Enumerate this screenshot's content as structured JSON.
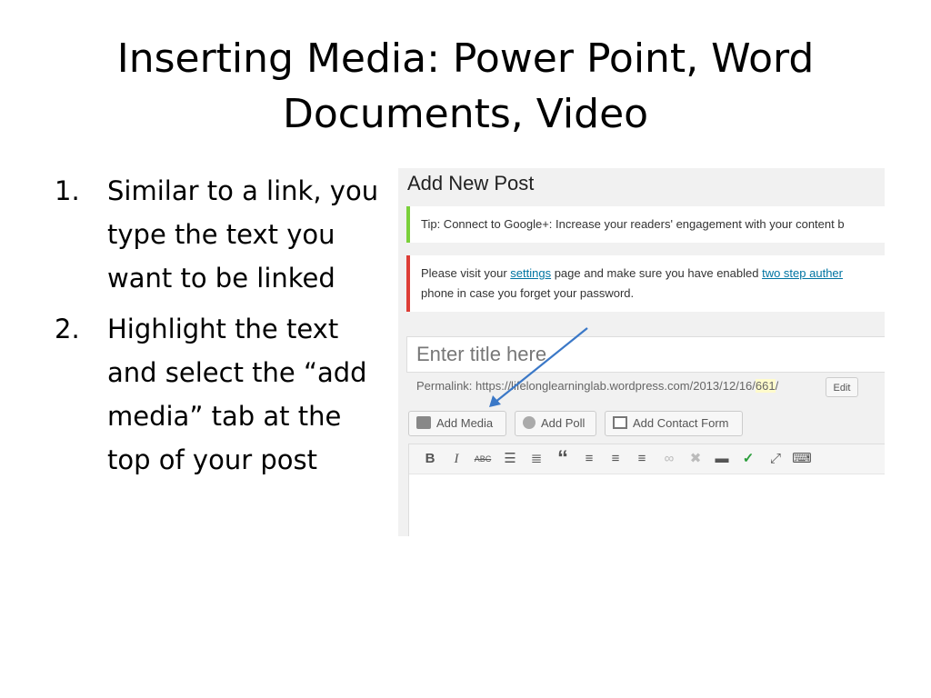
{
  "slide": {
    "title_line1": "Inserting Media: Power Point, Word",
    "title_line2": "Documents, Video",
    "steps": [
      {
        "num": "1.",
        "text": "Similar to a link, you type the text you want to be linked"
      },
      {
        "num": "2.",
        "text": "Highlight the text and select the “add media” tab at the top of your post"
      }
    ]
  },
  "screenshot": {
    "heading": "Add New Post",
    "tip_notice": "Tip: Connect to Google+: Increase your readers' engagement with your content b",
    "warning": {
      "prefix": "Please visit your ",
      "link1": "settings",
      "middle": " page and make sure you have enabled ",
      "link2": "two step auther",
      "line2": "phone in case you forget your password."
    },
    "title_placeholder": "Enter title here",
    "permalink": {
      "label": "Permalink: ",
      "url_start": "https://lifelonglearninglab.wordpress.com/2013/12/16/",
      "url_id": "661",
      "url_end": "/"
    },
    "edit_label": "Edit",
    "buttons": {
      "add_media": "Add Media",
      "add_poll": "Add Poll",
      "add_contact_form": "Add Contact Form"
    },
    "toolbar_icons": [
      {
        "name": "bold-icon",
        "glyph": "B"
      },
      {
        "name": "italic-icon",
        "glyph": "I"
      },
      {
        "name": "strikethrough-icon",
        "glyph": "ABC"
      },
      {
        "name": "bullet-list-icon",
        "glyph": "☰"
      },
      {
        "name": "numbered-list-icon",
        "glyph": "≣"
      },
      {
        "name": "blockquote-icon",
        "glyph": "“"
      },
      {
        "name": "align-left-icon",
        "glyph": "≡"
      },
      {
        "name": "align-center-icon",
        "glyph": "≡"
      },
      {
        "name": "align-right-icon",
        "glyph": "≡"
      },
      {
        "name": "insert-link-icon",
        "glyph": "∞"
      },
      {
        "name": "unlink-icon",
        "glyph": "✖"
      },
      {
        "name": "insert-more-icon",
        "glyph": "▬"
      },
      {
        "name": "spellcheck-icon",
        "glyph": "✓"
      },
      {
        "name": "fullscreen-icon",
        "glyph": "⤢"
      },
      {
        "name": "kitchen-sink-icon",
        "glyph": "⌨"
      }
    ],
    "colors": {
      "tip_border": "#7ad03a",
      "warning_border": "#dd3d36",
      "link": "#0074a2",
      "arrow": "#3b78c7"
    }
  }
}
